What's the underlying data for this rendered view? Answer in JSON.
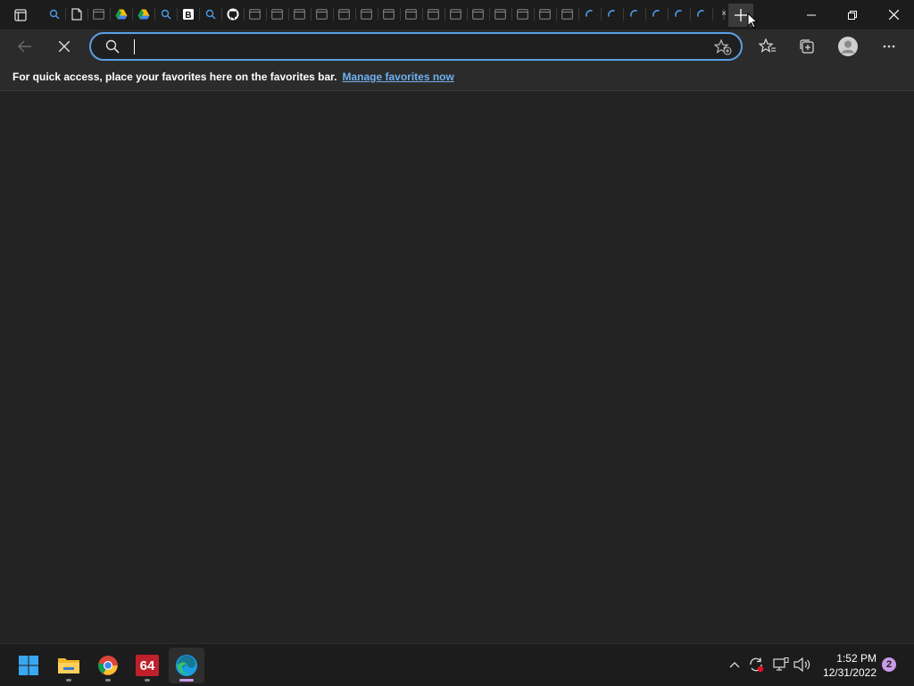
{
  "browser": {
    "tabs": [
      {
        "icon": "search-icon"
      },
      {
        "icon": "document-icon"
      },
      {
        "icon": "page-icon"
      },
      {
        "icon": "drive-icon"
      },
      {
        "icon": "drive-icon"
      },
      {
        "icon": "search-icon"
      },
      {
        "icon": "bold-b-icon"
      },
      {
        "icon": "search-icon"
      },
      {
        "icon": "github-icon"
      },
      {
        "icon": "page-icon"
      },
      {
        "icon": "page-icon"
      },
      {
        "icon": "page-icon"
      },
      {
        "icon": "page-icon"
      },
      {
        "icon": "page-icon"
      },
      {
        "icon": "page-icon"
      },
      {
        "icon": "page-icon"
      },
      {
        "icon": "page-icon"
      },
      {
        "icon": "page-icon"
      },
      {
        "icon": "page-icon"
      },
      {
        "icon": "page-icon"
      },
      {
        "icon": "page-icon"
      },
      {
        "icon": "page-icon"
      },
      {
        "icon": "page-icon"
      },
      {
        "icon": "page-icon"
      },
      {
        "icon": "loading-spinner-icon"
      },
      {
        "icon": "loading-spinner-icon"
      },
      {
        "icon": "loading-spinner-icon"
      },
      {
        "icon": "loading-spinner-icon"
      },
      {
        "icon": "loading-spinner-icon"
      },
      {
        "icon": "loading-spinner-icon"
      },
      {
        "icon": "blank-icon"
      }
    ],
    "active_tab_close": "×",
    "new_tab_label": "+",
    "address": {
      "value": "",
      "placeholder": ""
    },
    "favorites_bar": {
      "message": "For quick access, place your favorites here on the favorites bar.",
      "link": "Manage favorites now"
    }
  },
  "taskbar": {
    "apps": [
      {
        "name": "start",
        "icon": "windows-logo-icon"
      },
      {
        "name": "file-explorer",
        "icon": "folder-icon"
      },
      {
        "name": "chrome",
        "icon": "chrome-icon"
      },
      {
        "name": "aida64",
        "icon": "aida64-icon",
        "label": "64"
      },
      {
        "name": "edge",
        "icon": "edge-icon"
      }
    ],
    "clock": {
      "time": "1:52 PM",
      "date": "12/31/2022"
    },
    "notifications": "2"
  },
  "colors": {
    "accent": "#5aa0e6",
    "link": "#6fb0ee",
    "notification": "#c99ae8",
    "aida_red": "#c0202a"
  }
}
